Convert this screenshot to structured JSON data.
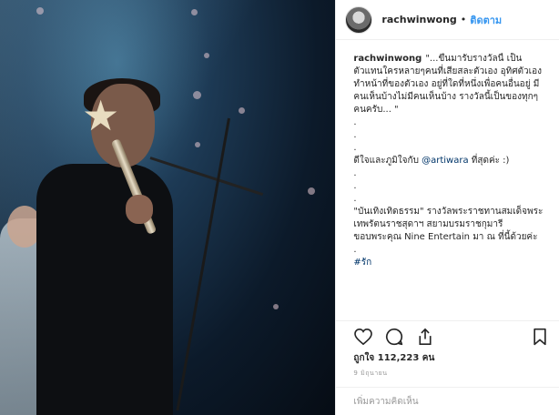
{
  "post": {
    "username": "rachwinwong",
    "separator": "•",
    "follow_label": "ติดตาม"
  },
  "caption": {
    "username": "rachwinwong",
    "text": "\"...ขึ้นมารับรางวัลนี้ เป็นตัวแทนใครหลายๆคนที่เสียสละตัวเอง อุทิศตัวเอง ทำหน้าที่ของตัวเอง อยู่ที่ใดที่หนึ่งเพื่อคนอื่นอยู่ มีคนเห็นบ้างไม่มีคนเห็นบ้าง รางวัลนี้เป็นของทุกๆคนครับ... \"",
    "dots_a": [
      ".",
      ".",
      "."
    ],
    "thanks_prefix": "ดีใจและภูมิใจกับ ",
    "mention": "@artiwara",
    "thanks_suffix": " ที่สุดค่ะ :)",
    "dots_b": [
      ".",
      ".",
      "."
    ],
    "award_text": "\"บันเทิงเทิดธรรม\" รางวัลพระราชทานสมเด็จพระเทพรัตนราชสุดาฯ สยามบรมราชกุมารี",
    "thanks_nine": "ขอบพระคุณ Nine Entertain มา ณ ที่นี้ด้วยค่ะ",
    "dots_c": [
      "."
    ],
    "hashtag": "#รัก"
  },
  "actions": {
    "like_icon": "heart-icon",
    "comment_icon": "comment-icon",
    "share_icon": "share-icon",
    "save_icon": "bookmark-icon"
  },
  "likes_text": "ถูกใจ 112,223 คน",
  "date_text": "9 มิถุนายน",
  "comment_placeholder": "เพิ่มความคิดเห็น",
  "colors": {
    "link": "#3897f0",
    "mention": "#003569",
    "muted": "#999999"
  }
}
